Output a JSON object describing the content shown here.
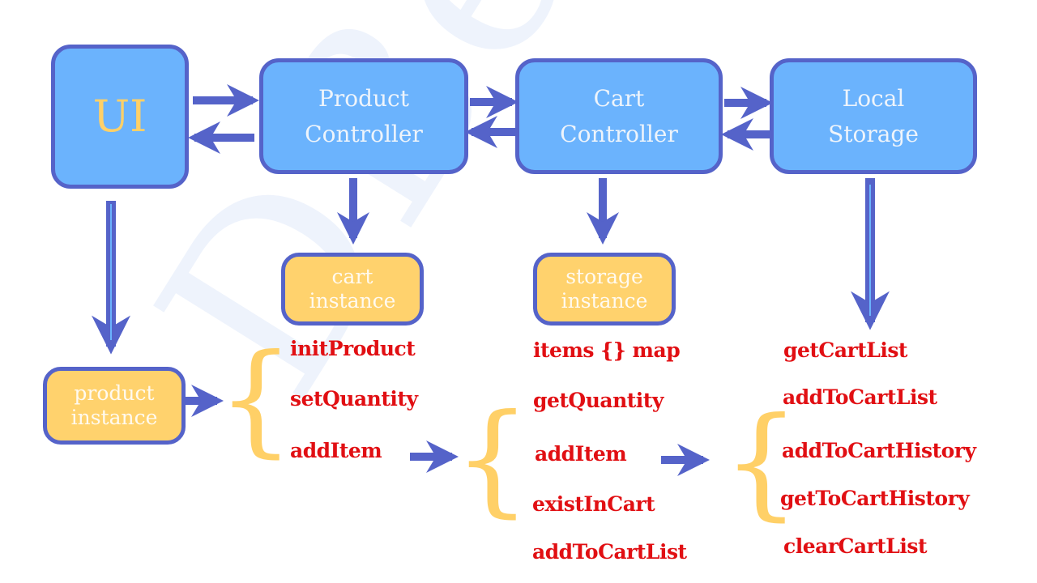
{
  "watermark": "DBestech",
  "colors": {
    "box_fill": "#6bb3fd",
    "box_border": "#5563c9",
    "instance_fill": "#ffd26d",
    "method_text": "#e10f13",
    "brace": "#ffd067",
    "arrow": "#5563c9"
  },
  "nodes": {
    "ui": {
      "label": "UI"
    },
    "product_controller": {
      "line1": "Product",
      "line2": "Controller"
    },
    "cart_controller": {
      "line1": "Cart",
      "line2": "Controller"
    },
    "local_storage": {
      "line1": "Local",
      "line2": "Storage"
    }
  },
  "instances": {
    "product": {
      "line1": "product",
      "line2": "instance"
    },
    "cart": {
      "line1": "cart",
      "line2": "instance"
    },
    "storage": {
      "line1": "storage",
      "line2": "instance"
    }
  },
  "methods": {
    "product_instance": [
      "initProduct",
      "setQuantity",
      "addItem"
    ],
    "cart_instance": [
      "items {} map",
      "getQuantity",
      "addItem",
      "existInCart",
      "addToCartList"
    ],
    "storage_instance": [
      "getCartList",
      "addToCartList",
      "addToCartHistory",
      "getToCartHistory",
      "clearCartList"
    ]
  },
  "braces": {
    "glyph": "{"
  }
}
